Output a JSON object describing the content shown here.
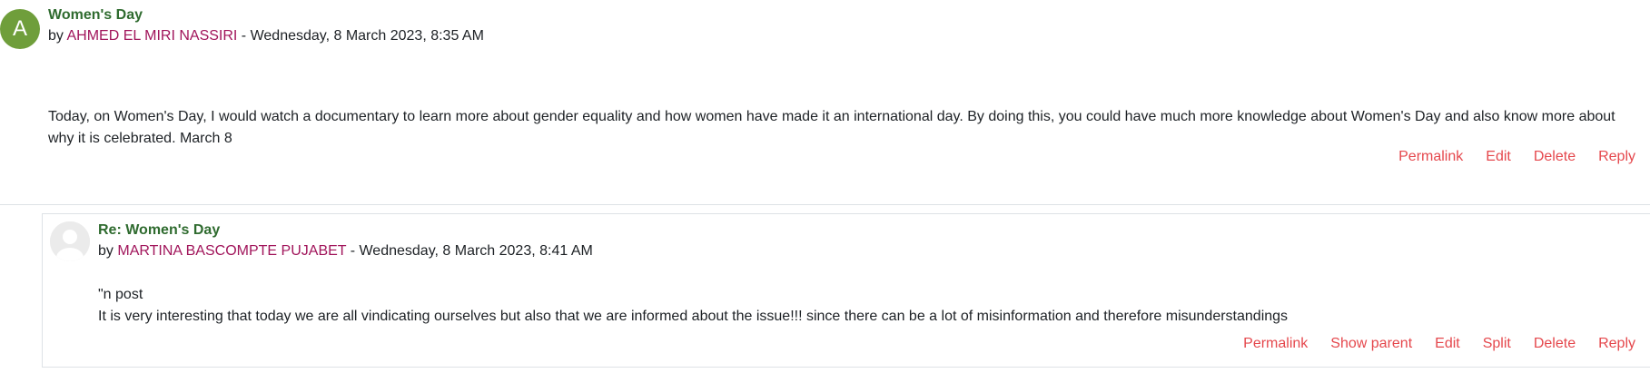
{
  "post": {
    "avatar_letter": "A",
    "subject": "Women's Day",
    "by_prefix": "by",
    "author": "AHMED EL MIRI NASSIRI",
    "date_separator": " - ",
    "date": "Wednesday, 8 March 2023, 8:35 AM",
    "body": "Today, on Women's Day, I would watch a documentary to learn more about gender equality and how women have made it an international day. By doing this, you could have much more knowledge about Women's Day and also know more about why it is celebrated. March 8",
    "commands": {
      "permalink": "Permalink",
      "edit": "Edit",
      "delete": "Delete",
      "reply": "Reply"
    }
  },
  "reply": {
    "subject": "Re: Women's Day",
    "by_prefix": "by",
    "author": "MARTINA BASCOMPTE PUJABET",
    "date_separator": " - ",
    "date": "Wednesday, 8 March 2023, 8:41 AM",
    "body_line1": "\"n post",
    "body_line2": "It is very interesting that today we are all vindicating ourselves but also that we are informed about the issue!!! since there can be a lot of misinformation and therefore misunderstandings",
    "commands": {
      "permalink": "Permalink",
      "show_parent": "Show parent",
      "edit": "Edit",
      "split": "Split",
      "delete": "Delete",
      "reply": "Reply"
    }
  },
  "colors": {
    "subject": "#2f6b2f",
    "author_link": "#a1155b",
    "command_link": "#e5484d",
    "avatar_bg": "#6f9e3b"
  }
}
